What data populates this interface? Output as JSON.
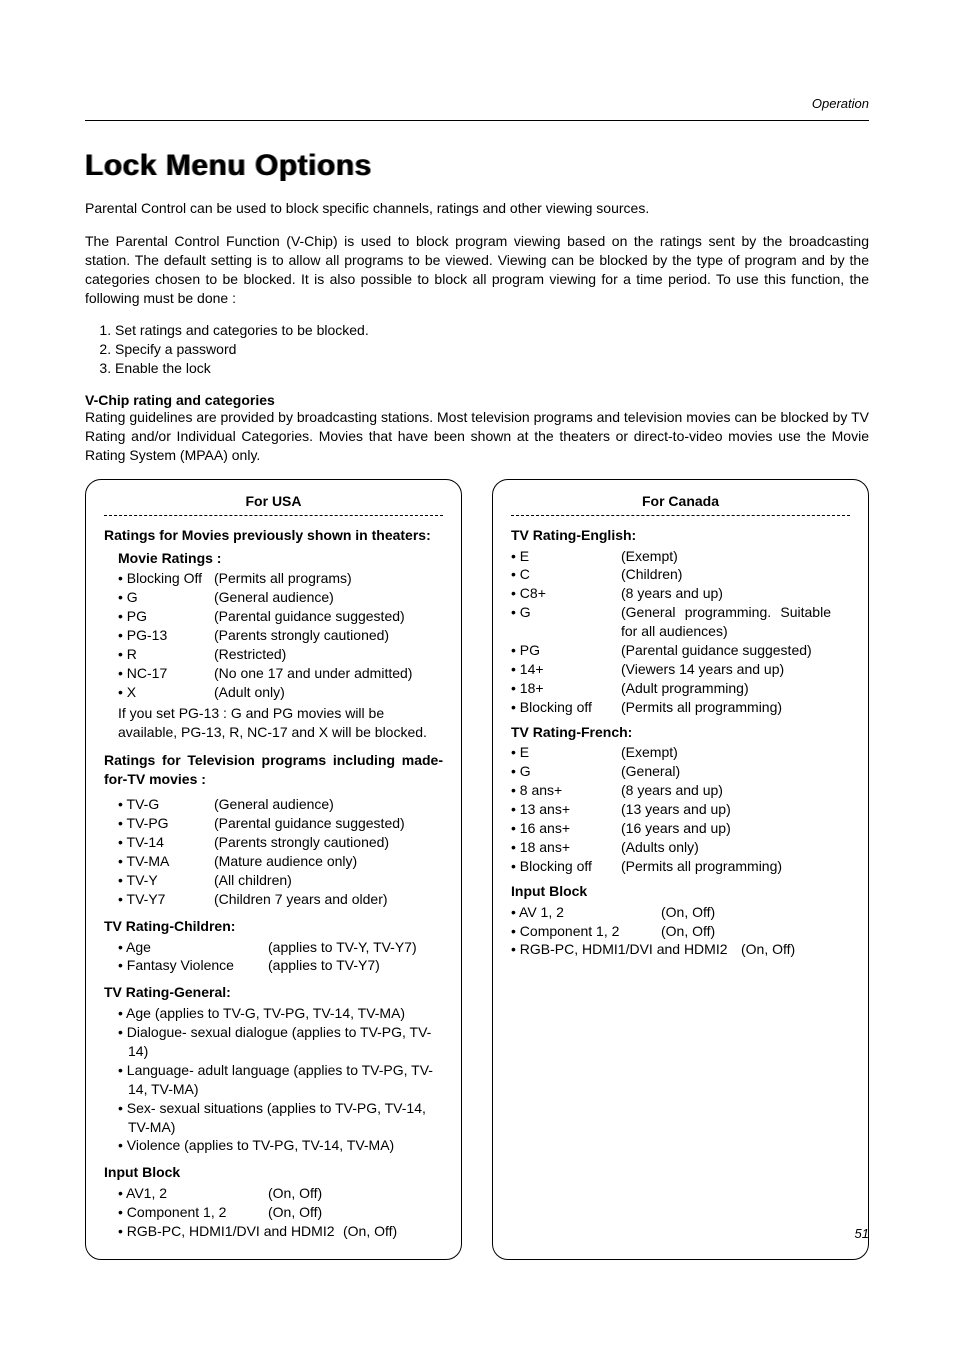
{
  "header": {
    "section": "Operation"
  },
  "title": "Lock Menu Options",
  "intro1": "Parental Control can be used to block specific channels, ratings and other viewing sources.",
  "intro2": "The Parental Control Function (V-Chip) is used to block program viewing based on the ratings sent by the broadcasting station. The default setting is to allow all programs to be viewed. Viewing can be blocked by the type of program and by the categories chosen to be blocked. It is also possible to block all program viewing for a time period. To use this function, the following must be done :",
  "steps": [
    "Set ratings and categories to be blocked.",
    "Specify a password",
    "Enable the lock"
  ],
  "vchip": {
    "heading": "V-Chip rating and categories",
    "body": "Rating guidelines are provided by broadcasting stations. Most television programs and television movies can be blocked by TV Rating and/or Individual Categories. Movies that have been shown at the theaters or direct-to-video movies use the Movie Rating System (MPAA) only."
  },
  "usa": {
    "title": "For USA",
    "movies_prev": "Ratings for Movies previously shown in theaters:",
    "movie_ratings_label": "Movie Ratings :",
    "movie_ratings": [
      {
        "k": "• Blocking Off",
        "v": "(Permits all programs)"
      },
      {
        "k": "• G",
        "v": "(General audience)"
      },
      {
        "k": "• PG",
        "v": "(Parental guidance suggested)"
      },
      {
        "k": "• PG-13",
        "v": "(Parents strongly cautioned)"
      },
      {
        "k": "• R",
        "v": "(Restricted)"
      },
      {
        "k": "• NC-17",
        "v": "(No one 17 and under admitted)"
      },
      {
        "k": "• X",
        "v": "(Adult only)"
      }
    ],
    "movie_note": "If you set PG-13 : G and PG movies will be available, PG-13, R, NC-17 and X will be blocked.",
    "tv_heading": "Ratings for Television programs including made-for-TV movies :",
    "tv_ratings": [
      {
        "k": "• TV-G",
        "v": "(General audience)"
      },
      {
        "k": "• TV-PG",
        "v": "(Parental guidance suggested)"
      },
      {
        "k": "• TV-14",
        "v": "(Parents strongly cautioned)"
      },
      {
        "k": "• TV-MA",
        "v": "(Mature audience only)"
      },
      {
        "k": "• TV-Y",
        "v": "(All children)"
      },
      {
        "k": "• TV-Y7",
        "v": "(Children 7 years and older)"
      }
    ],
    "children_heading": "TV Rating-Children:",
    "children": [
      {
        "k": "• Age",
        "v": "(applies to TV-Y, TV-Y7)"
      },
      {
        "k": "• Fantasy Violence",
        "v": "(applies to TV-Y7)"
      }
    ],
    "general_heading": "TV Rating-General:",
    "general": [
      "• Age  (applies to TV-G, TV-PG, TV-14, TV-MA)",
      "• Dialogue- sexual dialogue (applies to TV-PG, TV-14)",
      "• Language- adult language (applies to TV-PG, TV-14, TV-MA)",
      "• Sex- sexual situations (applies to TV-PG, TV-14, TV-MA)",
      "• Violence (applies to TV-PG, TV-14, TV-MA)"
    ],
    "input_heading": "Input Block",
    "input": [
      {
        "k": "• AV1, 2",
        "v": "(On, Off)"
      },
      {
        "k": "• Component 1, 2",
        "v": "(On, Off)"
      },
      {
        "k": "• RGB-PC, HDMI1/DVI and HDMI2",
        "v": "(On, Off)"
      }
    ]
  },
  "canada": {
    "title": "For Canada",
    "eng_heading": "TV Rating-English:",
    "eng": [
      {
        "k": "• E",
        "v": "(Exempt)"
      },
      {
        "k": "• C",
        "v": "(Children)"
      },
      {
        "k": "• C8+",
        "v": "(8 years and up)"
      },
      {
        "k": "• G",
        "v": "(General programming. Suitable for all audiences)"
      },
      {
        "k": "• PG",
        "v": "(Parental guidance suggested)"
      },
      {
        "k": "• 14+",
        "v": "(Viewers 14 years and up)"
      },
      {
        "k": "• 18+",
        "v": "(Adult programming)"
      },
      {
        "k": "• Blocking off",
        "v": "(Permits all programming)"
      }
    ],
    "fr_heading": "TV Rating-French:",
    "fr": [
      {
        "k": "• E",
        "v": "(Exempt)"
      },
      {
        "k": "• G",
        "v": "(General)"
      },
      {
        "k": "• 8 ans+",
        "v": "(8 years and up)"
      },
      {
        "k": "• 13 ans+",
        "v": "(13 years and up)"
      },
      {
        "k": "• 16 ans+",
        "v": "(16 years and up)"
      },
      {
        "k": "• 18 ans+",
        "v": "(Adults only)"
      },
      {
        "k": "• Blocking off",
        "v": "(Permits all programming)"
      }
    ],
    "input_heading": "Input Block",
    "input": [
      {
        "k": "• AV 1, 2",
        "v": "(On, Off)"
      },
      {
        "k": "• Component 1, 2",
        "v": "(On, Off)"
      },
      {
        "k": "• RGB-PC, HDMI1/DVI and HDMI2",
        "v": "(On, Off)"
      }
    ]
  },
  "page_number": "51"
}
